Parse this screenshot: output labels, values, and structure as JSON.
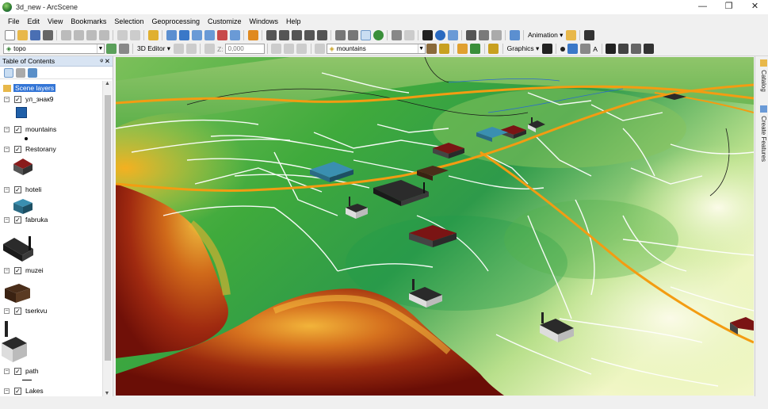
{
  "window": {
    "title": "3d_new - ArcScene",
    "minimize_icon": "—",
    "maximize_icon": "❐",
    "close_icon": "✕"
  },
  "menu": [
    "File",
    "Edit",
    "View",
    "Bookmarks",
    "Selection",
    "Geoprocessing",
    "Customize",
    "Windows",
    "Help"
  ],
  "toolbar": {
    "animation_label": "Animation ▾",
    "layer_dropdown": "topo",
    "editor_label": "3D Editor ▾",
    "z_label": "Z:",
    "z_value": "0,000",
    "target_layer": "mountains",
    "graphics_label": "Graphics ▾",
    "font_icon": "A"
  },
  "toc": {
    "title": "Table of Contents",
    "pin": "ᵠ",
    "close": "✕",
    "root": "Scene layers",
    "layers": [
      {
        "name": "ул_знак9",
        "checked": true
      },
      {
        "name": "mountains",
        "checked": true
      },
      {
        "name": "Restorany",
        "checked": true
      },
      {
        "name": "hoteli",
        "checked": true
      },
      {
        "name": "fabruka",
        "checked": true
      },
      {
        "name": "muzei",
        "checked": true
      },
      {
        "name": "tserkvu",
        "checked": true
      },
      {
        "name": "path",
        "checked": true
      },
      {
        "name": "Lakes",
        "checked": true
      }
    ],
    "check_glyph": "✓",
    "expand_glyph": "−"
  },
  "side_tabs": {
    "catalog": "Catalog",
    "create_features": "Create Features"
  },
  "colors": {
    "terrain_low": "#a6d96a",
    "terrain_mid": "#1a9641",
    "terrain_high": "#d7191c",
    "terrain_peak": "#fdae61",
    "road_major": "#f39c12",
    "road_minor": "#ffffff",
    "toc_header": "#d8e4f3"
  }
}
